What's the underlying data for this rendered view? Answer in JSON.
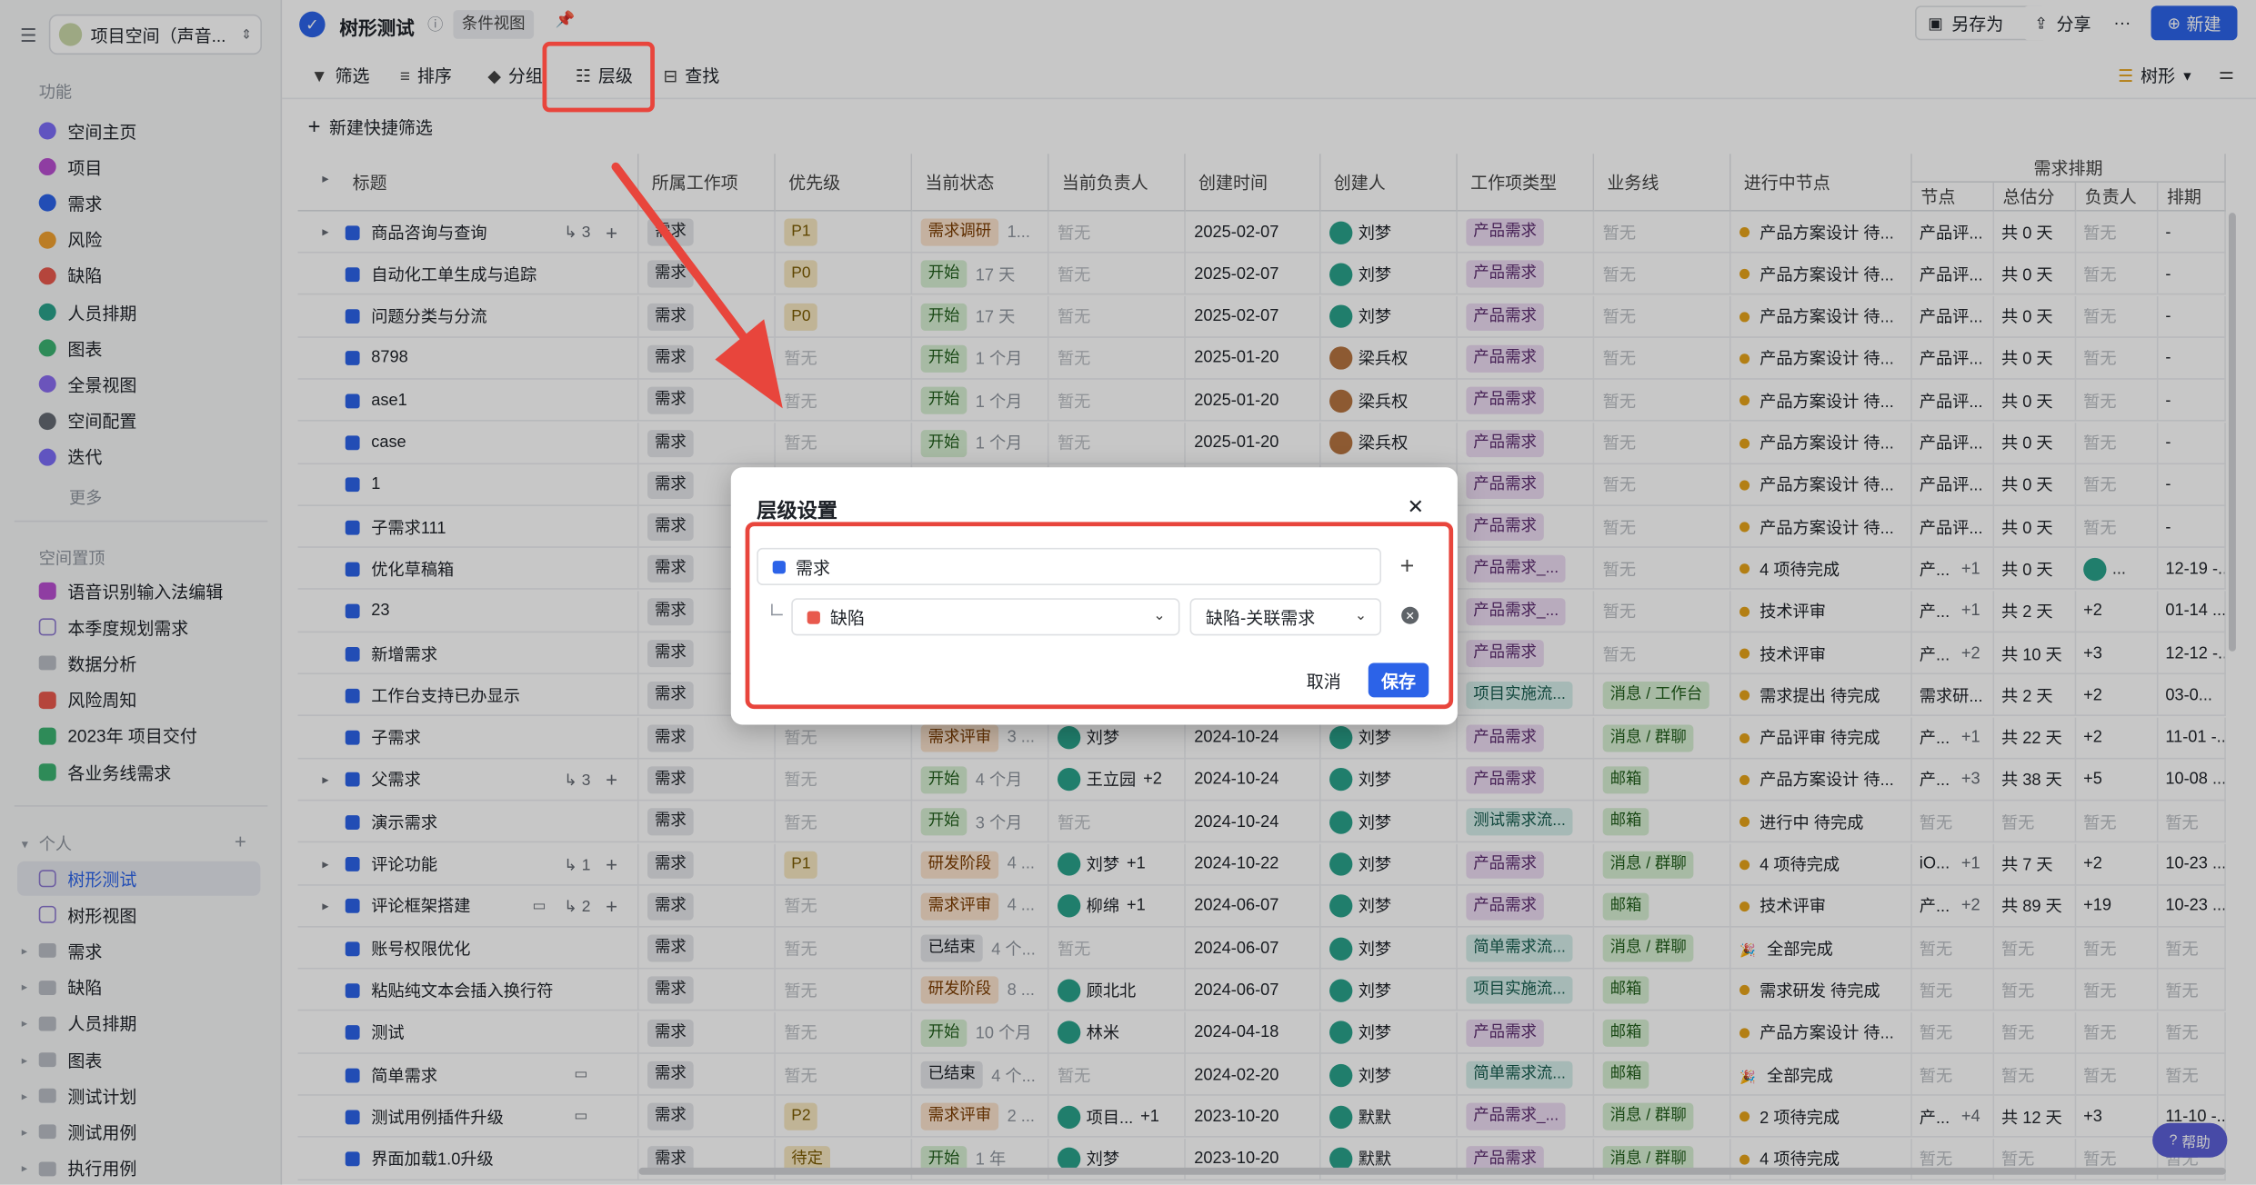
{
  "colors": {
    "primary": "#2c63e8",
    "highlight": "#e8453c",
    "demand": "#2c63e8",
    "defect": "#e8594d"
  },
  "sidebar": {
    "workspace": "项目空间（声音...",
    "section_features": "功能",
    "features": [
      {
        "label": "空间主页",
        "color": "#7b6cf6",
        "icon": "home-icon"
      },
      {
        "label": "项目",
        "color": "#b84fd0",
        "icon": "project-icon"
      },
      {
        "label": "需求",
        "color": "#2c63e8",
        "icon": "demand-icon"
      },
      {
        "label": "风险",
        "color": "#f0a030",
        "icon": "risk-icon"
      },
      {
        "label": "缺陷",
        "color": "#e8594d",
        "icon": "bug-icon"
      },
      {
        "label": "人员排期",
        "color": "#2aa28b",
        "icon": "schedule-icon"
      },
      {
        "label": "图表",
        "color": "#3cb371",
        "icon": "chart-icon"
      },
      {
        "label": "全景视图",
        "color": "#8a6cf0",
        "icon": "panorama-icon"
      },
      {
        "label": "空间配置",
        "color": "#646a73",
        "icon": "config-icon"
      },
      {
        "label": "迭代",
        "color": "#7b6cf6",
        "icon": "iteration-icon"
      }
    ],
    "more": "更多",
    "section_pinned": "空间置顶",
    "pinned": [
      {
        "label": "语音识别输入法编辑",
        "type": "purple"
      },
      {
        "label": "本季度规划需求",
        "type": "doc"
      },
      {
        "label": "数据分析",
        "type": "folder"
      },
      {
        "label": "风险周知",
        "type": "red",
        "prefix": "!"
      },
      {
        "label": "2023年 项目交付",
        "type": "green",
        "prefix": "📌"
      },
      {
        "label": "各业务线需求",
        "type": "green",
        "prefix": "✳"
      }
    ],
    "section_personal": "个人",
    "personal": [
      {
        "label": "树形测试",
        "type": "doc",
        "selected": true
      },
      {
        "label": "树形视图",
        "type": "doc"
      },
      {
        "label": "需求",
        "type": "folder"
      },
      {
        "label": "缺陷",
        "type": "folder"
      },
      {
        "label": "人员排期",
        "type": "folder"
      },
      {
        "label": "图表",
        "type": "folder"
      },
      {
        "label": "测试计划",
        "type": "folder"
      },
      {
        "label": "测试用例",
        "type": "folder"
      },
      {
        "label": "执行用例",
        "type": "folder"
      }
    ]
  },
  "topbar": {
    "title": "树形测试",
    "view_tag": "条件视图",
    "save_as": "另存为",
    "share": "分享",
    "more": "···",
    "new": "新建"
  },
  "toolbar": {
    "filter": "筛选",
    "sort": "排序",
    "group": "分组",
    "level": "层级",
    "find": "查找",
    "view_mode": "树形",
    "quick_filter": "新建快捷筛选"
  },
  "table": {
    "headers": [
      "标题",
      "所属工作项",
      "优先级",
      "当前状态",
      "当前负责人",
      "创建时间",
      "创建人",
      "工作项类型",
      "业务线",
      "进行中节点"
    ],
    "group_header": "需求排期",
    "sub_headers": [
      "节点",
      "总估分",
      "负责人",
      "排期"
    ],
    "rows": [
      {
        "title": "商品咨询与查询",
        "expand": true,
        "sub": "3",
        "item": "需求",
        "prio": "P1",
        "status": "需求调研",
        "dur": "1...",
        "owner": "暂无",
        "created": "2025-02-07",
        "creator": "刘梦",
        "type": "产品需求",
        "line": "暂无",
        "node": "产品方案设计 待...",
        "n1": "产品评...",
        "n2": "共 0 天",
        "n3": "暂无",
        "n4": "-"
      },
      {
        "title": "自动化工单生成与追踪",
        "item": "需求",
        "prio": "P0",
        "status": "开始",
        "dur": "17 天",
        "owner": "暂无",
        "created": "2025-02-07",
        "creator": "刘梦",
        "type": "产品需求",
        "line": "暂无",
        "node": "产品方案设计 待...",
        "n1": "产品评...",
        "n2": "共 0 天",
        "n3": "暂无",
        "n4": "-"
      },
      {
        "title": "问题分类与分流",
        "item": "需求",
        "prio": "P0",
        "status": "开始",
        "dur": "17 天",
        "owner": "暂无",
        "created": "2025-02-07",
        "creator": "刘梦",
        "type": "产品需求",
        "line": "暂无",
        "node": "产品方案设计 待...",
        "n1": "产品评...",
        "n2": "共 0 天",
        "n3": "暂无",
        "n4": "-"
      },
      {
        "title": "8798",
        "item": "需求",
        "prio": "暂无",
        "status": "开始",
        "dur": "1 个月",
        "owner": "暂无",
        "created": "2025-01-20",
        "creator": "梁兵权",
        "type": "产品需求",
        "line": "暂无",
        "node": "产品方案设计 待...",
        "n1": "产品评...",
        "n2": "共 0 天",
        "n3": "暂无",
        "n4": "-"
      },
      {
        "title": "ase1",
        "item": "需求",
        "prio": "暂无",
        "status": "开始",
        "dur": "1 个月",
        "owner": "暂无",
        "created": "2025-01-20",
        "creator": "梁兵权",
        "type": "产品需求",
        "line": "暂无",
        "node": "产品方案设计 待...",
        "n1": "产品评...",
        "n2": "共 0 天",
        "n3": "暂无",
        "n4": "-"
      },
      {
        "title": "case",
        "item": "需求",
        "prio": "暂无",
        "status": "开始",
        "dur": "1 个月",
        "owner": "暂无",
        "created": "2025-01-20",
        "creator": "梁兵权",
        "type": "产品需求",
        "line": "暂无",
        "node": "产品方案设计 待...",
        "n1": "产品评...",
        "n2": "共 0 天",
        "n3": "暂无",
        "n4": "-"
      },
      {
        "title": "1",
        "item": "需求",
        "type": "产品需求",
        "line": "暂无",
        "node": "产品方案设计 待...",
        "n1": "产品评...",
        "n2": "共 0 天",
        "n3": "暂无",
        "n4": "-"
      },
      {
        "title": "子需求111",
        "item": "需求",
        "type": "产品需求",
        "line": "暂无",
        "node": "产品方案设计 待...",
        "n1": "产品评...",
        "n2": "共 0 天",
        "n3": "暂无",
        "n4": "-"
      },
      {
        "title": "优化草稿箱",
        "item": "需求",
        "type": "产品需求_...",
        "line": "暂无",
        "node": "4 项待完成",
        "n1": "产...",
        "n1b": "+1",
        "n2": "共 0 天",
        "n3": "...",
        "n4": "12-19 -..."
      },
      {
        "title": "23",
        "item": "需求",
        "type": "产品需求_...",
        "line": "暂无",
        "node": "技术评审",
        "n1": "产...",
        "n1b": "+1",
        "n2": "共 2 天",
        "n3": "+2",
        "n4": "01-14 ..."
      },
      {
        "title": "新增需求",
        "item": "需求",
        "type": "产品需求",
        "line": "暂无",
        "node": "技术评审",
        "n1": "产...",
        "n1b": "+2",
        "n2": "共 10 天",
        "n3": "+3",
        "n4": "12-12 -..."
      },
      {
        "title": "工作台支持已办显示",
        "item": "需求",
        "type": "项目实施流...",
        "line": "消息 / 工作台",
        "node": "需求提出 待完成",
        "n1": "需求研...",
        "n2": "共 2 天",
        "n3": "+2",
        "n4": "03-0..."
      },
      {
        "title": "子需求",
        "item": "需求",
        "prio": "暂无",
        "status": "需求评审",
        "dur": "3 ...",
        "owner": "刘梦",
        "created": "2024-10-24",
        "creator": "刘梦",
        "type": "产品需求",
        "line": "消息 / 群聊",
        "node": "产品评审 待完成",
        "n1": "产...",
        "n1b": "+1",
        "n2": "共 22 天",
        "n3": "+2",
        "n4": "11-01 -..."
      },
      {
        "title": "父需求",
        "expand": true,
        "sub": "3",
        "item": "需求",
        "prio": "暂无",
        "status": "开始",
        "dur": "4 个月",
        "owner": "王立园",
        "owner_more": "+2",
        "created": "2024-10-24",
        "creator": "刘梦",
        "type": "产品需求",
        "line": "邮箱",
        "node": "产品方案设计 待...",
        "n1": "产...",
        "n1b": "+3",
        "n2": "共 38 天",
        "n3": "+5",
        "n4": "10-08 ..."
      },
      {
        "title": "演示需求",
        "item": "需求",
        "prio": "暂无",
        "status": "开始",
        "dur": "3 个月",
        "owner": "暂无",
        "created": "2024-10-24",
        "creator": "刘梦",
        "type": "测试需求流...",
        "line": "邮箱",
        "node": "进行中 待完成",
        "n1": "暂无",
        "n2": "暂无",
        "n3": "暂无",
        "n4": "暂无"
      },
      {
        "title": "评论功能",
        "expand": true,
        "sub": "1",
        "item": "需求",
        "prio": "P1",
        "status": "研发阶段",
        "dur": "4 ...",
        "owner": "刘梦",
        "owner_more": "+1",
        "created": "2024-10-22",
        "creator": "刘梦",
        "type": "产品需求",
        "line": "消息 / 群聊",
        "node": "4 项待完成",
        "n1": "iO...",
        "n1b": "+1",
        "n2": "共 7 天",
        "n3": "+2",
        "n4": "10-23 ..."
      },
      {
        "title": "评论框架搭建",
        "expand": true,
        "sub": "2",
        "comment": true,
        "item": "需求",
        "prio": "暂无",
        "status": "需求评审",
        "dur": "4 ...",
        "owner": "柳绵",
        "owner_more": "+1",
        "created": "2024-06-07",
        "creator": "刘梦",
        "type": "产品需求",
        "line": "邮箱",
        "node": "技术评审",
        "n1": "产...",
        "n1b": "+2",
        "n2": "共 89 天",
        "n3": "+19",
        "n4": "10-23 ..."
      },
      {
        "title": "账号权限优化",
        "item": "需求",
        "prio": "暂无",
        "status": "已结束",
        "dur": "4 个...",
        "owner": "暂无",
        "created": "2024-06-07",
        "creator": "刘梦",
        "type": "简单需求流...",
        "line": "消息 / 群聊",
        "node": "全部完成",
        "n1": "暂无",
        "n2": "暂无",
        "n3": "暂无",
        "n4": "暂无"
      },
      {
        "title": "粘贴纯文本会插入换行符",
        "item": "需求",
        "prio": "暂无",
        "status": "研发阶段",
        "dur": "8 ...",
        "owner": "顾北北",
        "created": "2024-06-07",
        "creator": "刘梦",
        "type": "项目实施流...",
        "line": "邮箱",
        "node": "需求研发 待完成",
        "n1": "暂无",
        "n2": "暂无",
        "n3": "暂无",
        "n4": "暂无"
      },
      {
        "title": "测试",
        "item": "需求",
        "prio": "暂无",
        "status": "开始",
        "dur": "10 个月",
        "owner": "林米",
        "created": "2024-04-18",
        "creator": "刘梦",
        "type": "产品需求",
        "line": "邮箱",
        "node": "产品方案设计 待...",
        "n1": "暂无",
        "n2": "暂无",
        "n3": "暂无",
        "n4": "暂无"
      },
      {
        "title": "简单需求",
        "comment": true,
        "item": "需求",
        "prio": "暂无",
        "status": "已结束",
        "dur": "4 个...",
        "owner": "暂无",
        "created": "2024-02-20",
        "creator": "刘梦",
        "type": "简单需求流...",
        "line": "邮箱",
        "node": "全部完成",
        "n1": "暂无",
        "n2": "暂无",
        "n3": "暂无",
        "n4": "暂无"
      },
      {
        "title": "测试用例插件升级",
        "comment": true,
        "item": "需求",
        "prio": "P2",
        "status": "需求评审",
        "dur": "2 ...",
        "owner": "项目...",
        "owner_more": "+1",
        "created": "2023-10-20",
        "creator": "默默",
        "type": "产品需求_...",
        "line": "消息 / 群聊",
        "node": "2 项待完成",
        "n1": "产...",
        "n1b": "+4",
        "n2": "共 12 天",
        "n3": "+3",
        "n4": "11-10 -..."
      },
      {
        "title": "界面加载1.0升级",
        "item": "需求",
        "prio": "待定",
        "status": "开始",
        "dur": "1 年",
        "owner": "刘梦",
        "created": "2023-10-20",
        "creator": "默默",
        "type": "产品需求",
        "line": "消息 / 群聊",
        "node": "4 项待完成",
        "n1": "暂无",
        "n2": "暂无",
        "n3": "暂无",
        "n4": "暂无"
      }
    ]
  },
  "modal": {
    "title": "层级设置",
    "level1": "需求",
    "level2": "缺陷",
    "relation": "缺陷-关联需求",
    "cancel": "取消",
    "save": "保存"
  },
  "help": "帮助"
}
